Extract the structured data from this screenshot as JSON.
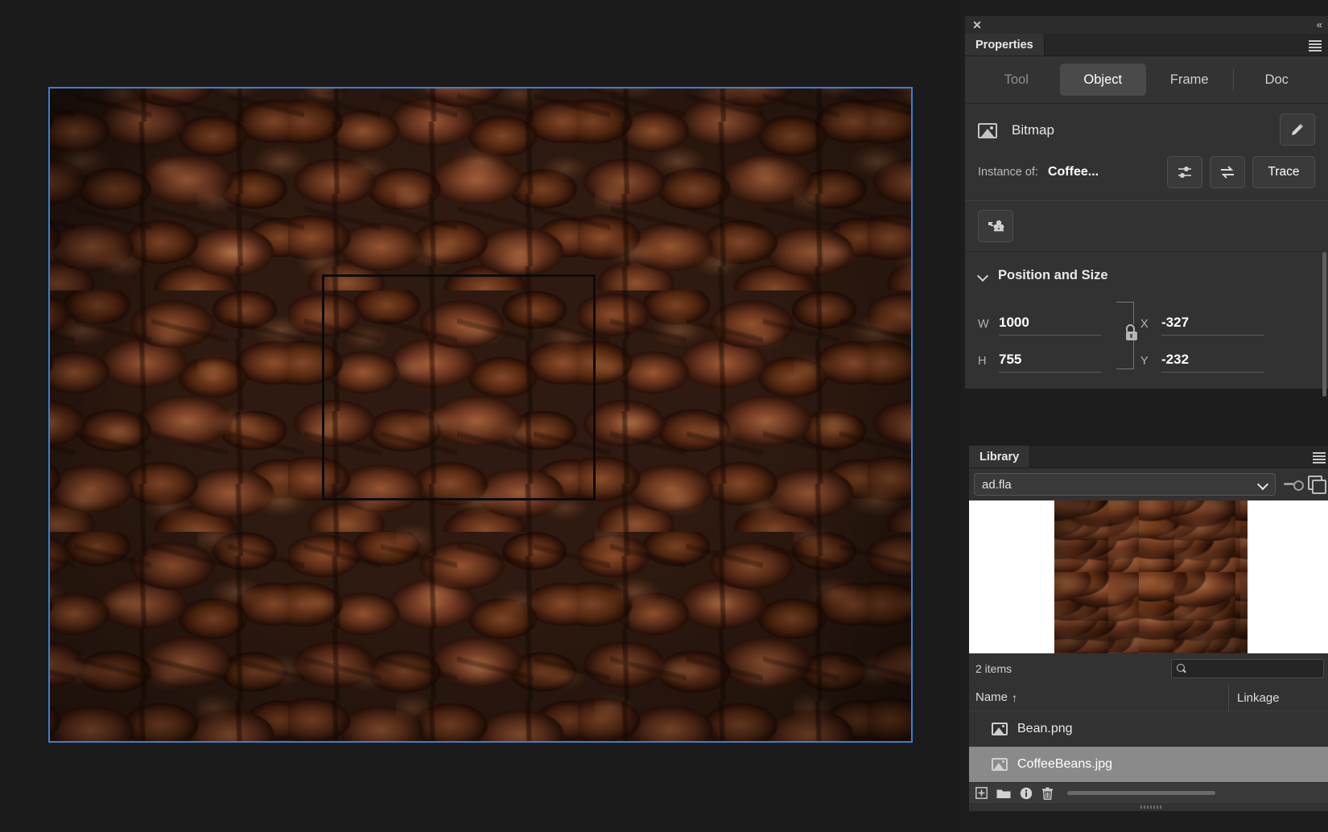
{
  "stage": {
    "canvas_name": "stage-canvas",
    "selection_border_color": "#3a7fd5",
    "selection_rect_color": "#0b0b0b",
    "artwork": "CoffeeBeans.jpg"
  },
  "dock": {
    "close_label": "✕",
    "collapse_label": "«"
  },
  "properties": {
    "tab_label": "Properties",
    "segments": [
      {
        "label": "Tool",
        "active": false,
        "dim": true
      },
      {
        "label": "Object",
        "active": true,
        "dim": false
      },
      {
        "label": "Frame",
        "active": false,
        "dim": false
      },
      {
        "label": "Doc",
        "active": false,
        "dim": false
      }
    ],
    "object": {
      "type_icon": "image-icon",
      "type_label": "Bitmap",
      "edit_button_icon": "pencil-icon",
      "instance_label": "Instance of:",
      "instance_value": "Coffee...",
      "adjust_button_icon": "sliders-icon",
      "swap_button_icon": "swap-arrows-icon",
      "trace_label": "Trace",
      "break_apart_icon": "break-apart-icon"
    },
    "position_and_size": {
      "title": "Position and Size",
      "expanded": true,
      "w_label": "W",
      "w_value": "1000",
      "h_label": "H",
      "h_value": "755",
      "x_label": "X",
      "x_value": "-327",
      "y_label": "Y",
      "y_value": "-232",
      "lock_state": "unlocked"
    }
  },
  "library": {
    "tab_label": "Library",
    "document": "ad.fla",
    "pin_icon": "pin-icon",
    "new_library_panel_icon": "duplicate-panel-icon",
    "count_label": "2 items",
    "search_placeholder": "",
    "search_value": "",
    "columns": {
      "name": "Name",
      "sort_indicator": "↑",
      "linkage": "Linkage"
    },
    "items": [
      {
        "name": "Bean.png",
        "icon": "bitmap-icon",
        "linkage": "",
        "selected": false
      },
      {
        "name": "CoffeeBeans.jpg",
        "icon": "bitmap-icon",
        "linkage": "",
        "selected": true
      }
    ],
    "bottom_bar": {
      "new_symbol_icon": "new-symbol-icon",
      "new_folder_icon": "new-folder-icon",
      "properties_icon": "info-icon",
      "delete_icon": "trash-icon",
      "slider_name": "library-width-slider"
    }
  }
}
